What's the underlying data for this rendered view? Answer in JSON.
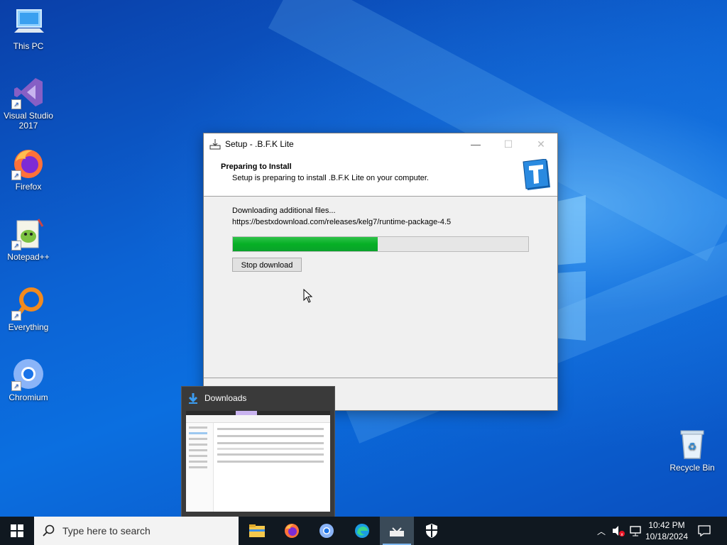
{
  "desktop": {
    "icons": [
      {
        "label": "This PC",
        "icon": "computer-icon"
      },
      {
        "label": "Visual Studio 2017",
        "icon": "visual-studio-icon"
      },
      {
        "label": "Firefox",
        "icon": "firefox-icon"
      },
      {
        "label": "Notepad++",
        "icon": "notepad-plus-plus-icon"
      },
      {
        "label": "Everything",
        "icon": "everything-search-icon"
      },
      {
        "label": "Chromium",
        "icon": "chromium-icon"
      },
      {
        "label": "Recycle Bin",
        "icon": "recycle-bin-icon"
      }
    ]
  },
  "setup_window": {
    "title": "Setup - .B.F.K Lite",
    "header_title": "Preparing to Install",
    "header_subtitle": "Setup is preparing to install .B.F.K Lite on your computer.",
    "status_line": "Downloading additional files...",
    "download_url": "https://bestxdownload.com/releases/kelg7/runtime-package-4.5",
    "progress_fraction": 0.49,
    "stop_button": "Stop download"
  },
  "thumbnail": {
    "title": "Downloads"
  },
  "taskbar": {
    "search_placeholder": "Type here to search",
    "pinned": [
      "file-explorer-icon",
      "firefox-icon",
      "chromium-icon",
      "edge-icon",
      "setup-icon",
      "security-shield-icon"
    ],
    "time": "10:42 PM",
    "date": "10/18/2024"
  },
  "colors": {
    "progress": "#06b025",
    "taskbar": "#101820",
    "desktop": "#0b63d4"
  }
}
